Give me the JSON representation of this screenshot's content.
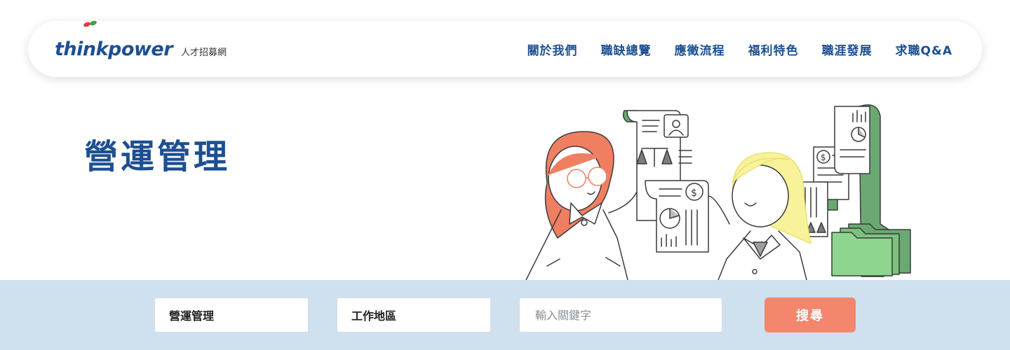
{
  "brand": {
    "wordmark": "thinkpower",
    "subtitle": "人才招募網",
    "dot_colors": [
      "#e53935",
      "#43a047"
    ]
  },
  "nav": {
    "items": [
      {
        "label": "關於我們"
      },
      {
        "label": "職缺總覽"
      },
      {
        "label": "應徵流程"
      },
      {
        "label": "福利特色"
      },
      {
        "label": "職涯發展"
      },
      {
        "label": "求職Q&A"
      }
    ]
  },
  "hero": {
    "title": "營運管理",
    "illustration": "two-professionals-with-documents"
  },
  "search": {
    "category_value": "營運管理",
    "location_value": "工作地區",
    "keyword_placeholder": "輸入關鍵字",
    "button_label": "搜尋"
  },
  "colors": {
    "brand_blue": "#1d4f91",
    "search_band": "#cfe1ef",
    "button_coral": "#f4866d",
    "doc_green": "#6aaa72",
    "folder_green": "#8ed68f",
    "hair_coral": "#f07f62",
    "hair_yellow": "#f8f39a"
  }
}
